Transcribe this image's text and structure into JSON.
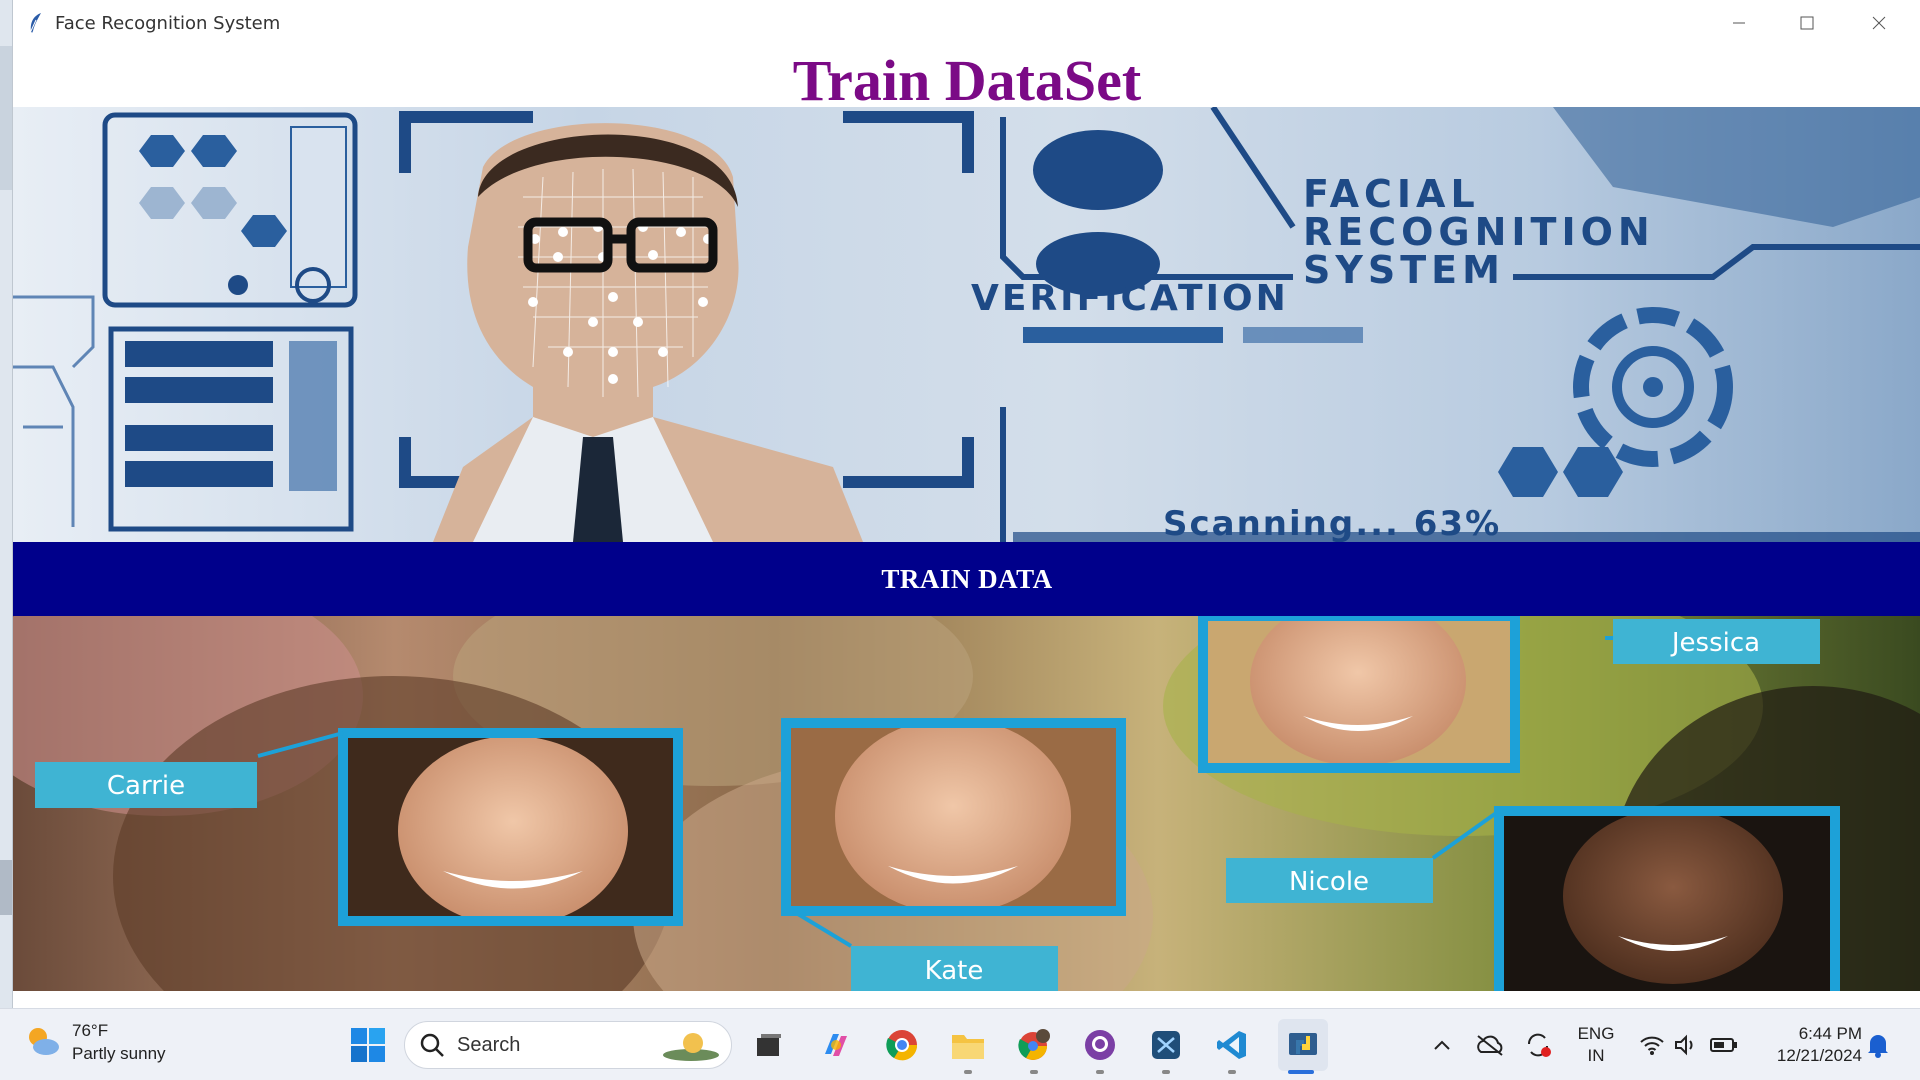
{
  "window": {
    "title": "Face Recognition System"
  },
  "page": {
    "heading": "Train DataSet",
    "train_button_label": "TRAIN DATA"
  },
  "banner": {
    "text_lines": [
      "FACIAL",
      "RECOGNITION",
      "SYSTEM"
    ],
    "verification_label": "VERIFICATION",
    "scanning_label": "Scanning... 63%"
  },
  "faces": {
    "labels": [
      "Carrie",
      "Kate",
      "Jessica",
      "Nicole"
    ]
  },
  "taskbar": {
    "weather_temp": "76°F",
    "weather_desc": "Partly sunny",
    "search_placeholder": "Search",
    "lang_top": "ENG",
    "lang_bottom": "IN",
    "time": "6:44 PM",
    "date": "12/21/2024"
  },
  "colors": {
    "heading": "#7b0a86",
    "train_button": "#00008b",
    "face_frame": "#1da1d8",
    "label_bg": "#3fb4d3"
  }
}
